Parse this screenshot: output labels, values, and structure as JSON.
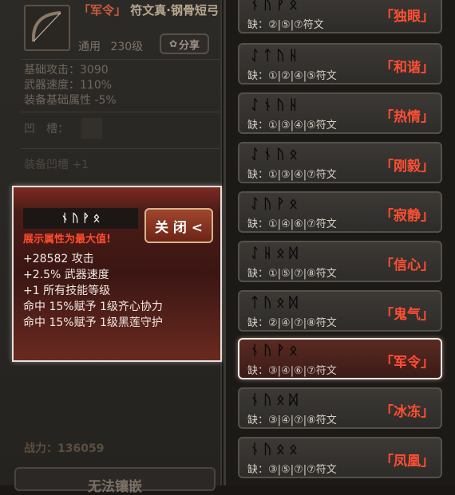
{
  "item": {
    "name_tag": "「军令」",
    "name_rest": "符文真·钢骨短弓",
    "type": "通用",
    "level": "230级",
    "share_label": "分享"
  },
  "stats": [
    "基础攻击：3090",
    "武器速度：110%",
    "装备基础属性 -5%"
  ],
  "socket_label": "凹　槽：",
  "socket_bonus": "装备凹槽 +1",
  "power": "战力：136059",
  "equip_label": "无法镶嵌",
  "popup": {
    "runes": "ᚾ ᚢ ᚹ ᛟ",
    "max_label": "展示属性为最大值!",
    "close_label": "关 闭 <",
    "lines": [
      "+28582 攻击",
      "+2.5% 武器速度",
      "+1 所有技能等级",
      "命中 15%赋予 1级齐心协力",
      "命中 15%赋予 1级黑莲守护"
    ]
  },
  "runewords": [
    {
      "runes": "ᚾ ᚢ ᚹ ᛟ",
      "req": "缺：②|⑤|⑦符文",
      "name": "「独眼」",
      "selected": false
    },
    {
      "runes": "ᛇ ᛏ ᚢ ᚺ",
      "req": "缺：①|②|④|⑤符文",
      "name": "「和谐」",
      "selected": false
    },
    {
      "runes": "ᛇ ᚾ ᚢ ᚺ",
      "req": "缺：①|③|④|⑤符文",
      "name": "「热情」",
      "selected": false
    },
    {
      "runes": "ᛇ ᚾ ᚢ ᛟ",
      "req": "缺：①|③|④|⑦符文",
      "name": "「刚毅」",
      "selected": false
    },
    {
      "runes": "ᛇ ᚢ ᚹ ᛟ",
      "req": "缺：①|④|⑥|⑦符文",
      "name": "「寂静」",
      "selected": false
    },
    {
      "runes": "ᛇ ᚺ ᛟ ᛞ",
      "req": "缺：①|⑤|⑦|⑧符文",
      "name": "「信心」",
      "selected": false
    },
    {
      "runes": "ᛏ ᚢ ᛟ ᛞ",
      "req": "缺：②|④|⑦|⑧符文",
      "name": "「鬼气」",
      "selected": false
    },
    {
      "runes": "ᚾ ᚢ ᚹ ᛟ",
      "req": "缺：③|④|⑥|⑦符文",
      "name": "「军令」",
      "selected": true
    },
    {
      "runes": "ᚾ ᚢ ᛟ ᛞ",
      "req": "缺：③|④|⑦|⑧符文",
      "name": "「冰冻」",
      "selected": false
    },
    {
      "runes": "ᚾ ᚢ ᛟ ᛟ",
      "req": "缺：③|⑤|⑦|⑦符文",
      "name": "「凤凰」",
      "selected": false
    }
  ]
}
